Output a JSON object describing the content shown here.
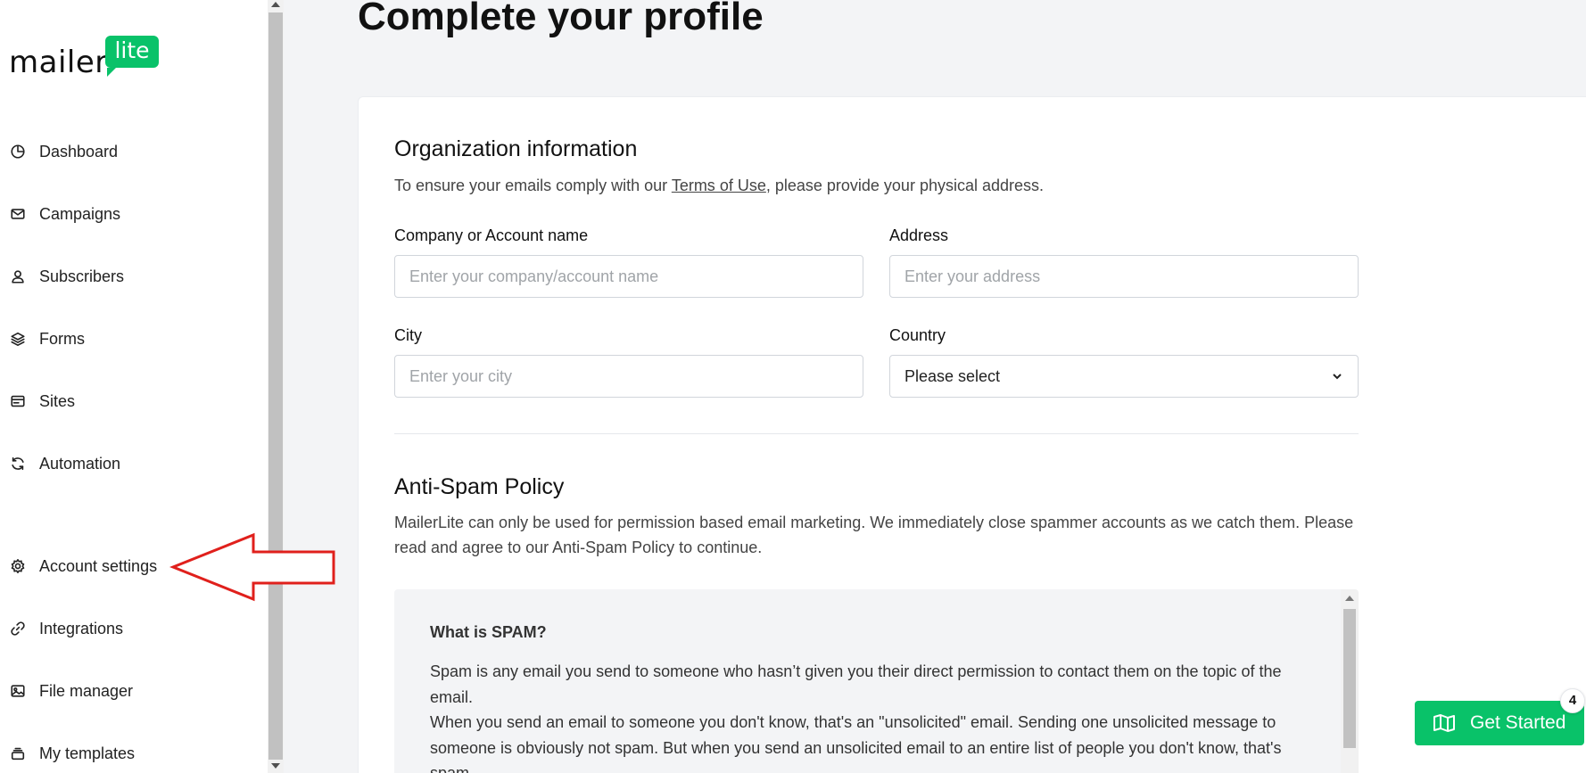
{
  "brand": {
    "logo_word": "mailer",
    "logo_badge": "lite",
    "accent_color": "#09c269"
  },
  "sidebar": {
    "items": [
      {
        "label": "Dashboard",
        "icon": "chart-pie-icon"
      },
      {
        "label": "Campaigns",
        "icon": "envelope-icon"
      },
      {
        "label": "Subscribers",
        "icon": "user-icon"
      },
      {
        "label": "Forms",
        "icon": "layers-icon"
      },
      {
        "label": "Sites",
        "icon": "browser-window-icon"
      },
      {
        "label": "Automation",
        "icon": "refresh-icon"
      },
      {
        "label": "Account settings",
        "icon": "gear-icon"
      },
      {
        "label": "Integrations",
        "icon": "link-icon"
      },
      {
        "label": "File manager",
        "icon": "image-icon"
      },
      {
        "label": "My templates",
        "icon": "stack-icon"
      }
    ]
  },
  "annotation": {
    "arrow_color": "#e0201c",
    "points_to": "Account settings"
  },
  "main": {
    "title": "Complete your profile",
    "org": {
      "title": "Organization information",
      "desc_before": "To ensure your emails comply with our ",
      "desc_link": "Terms of Use",
      "desc_after": ", please provide your physical address.",
      "company_label": "Company or Account name",
      "company_placeholder": "Enter your company/account name",
      "address_label": "Address",
      "address_placeholder": "Enter your address",
      "city_label": "City",
      "city_placeholder": "Enter your city",
      "country_label": "Country",
      "country_value": "Please select"
    },
    "spam": {
      "title": "Anti-Spam Policy",
      "desc": "MailerLite can only be used for permission based email marketing. We immediately close spammer accounts as we catch them. Please read and agree to our Anti-Spam Policy to continue.",
      "box_title": "What is SPAM?",
      "box_p1": "Spam is any email you send to someone who hasn’t given you their direct permission to contact them on the topic of the email.",
      "box_p2": "When you send an email to someone you don't know, that's an \"unsolicited\" email. Sending one unsolicited message to someone is obviously not spam. But when you send an unsolicited email to an entire list of people you don't know, that's spam."
    }
  },
  "get_started": {
    "label": "Get Started",
    "badge": "4"
  }
}
